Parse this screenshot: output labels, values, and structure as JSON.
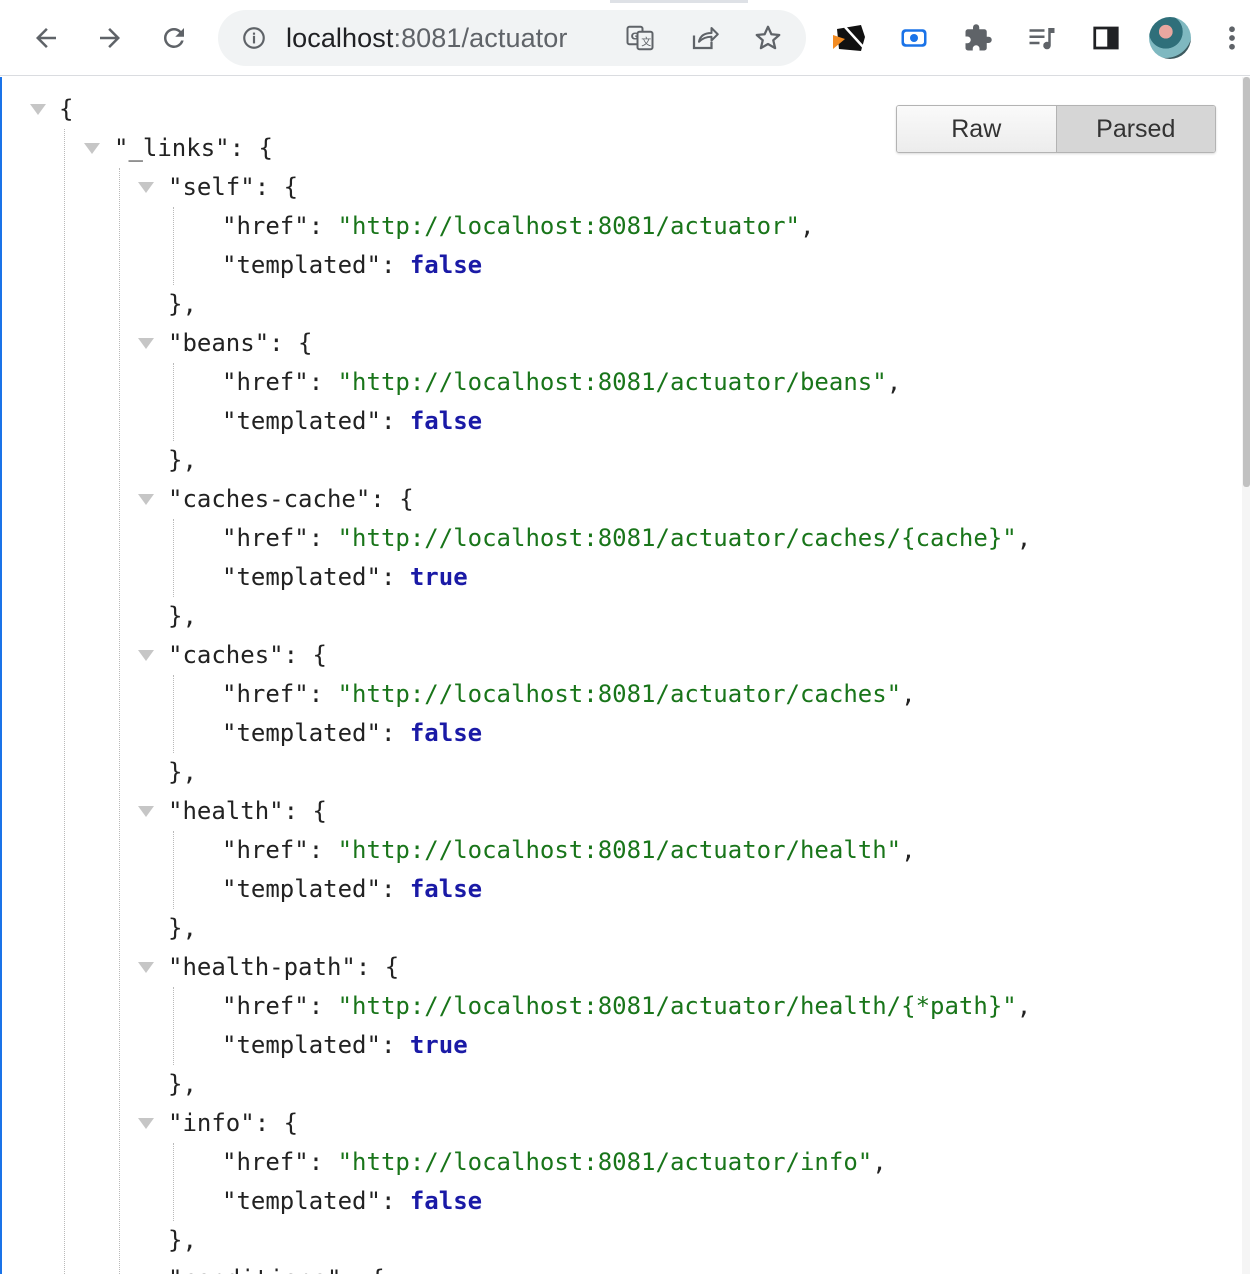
{
  "browser": {
    "url_host": "localhost",
    "url_port_path": ":8081/actuator",
    "icons": {
      "back": "arrow-left-icon",
      "forward": "arrow-right-icon",
      "reload": "reload-icon",
      "info": "info-icon",
      "translate": "translate-icon",
      "share": "share-icon",
      "bookmark": "star-icon",
      "extension1": "json-extension-icon",
      "extension2": "screen-record-icon",
      "extensions": "puzzle-icon",
      "media": "media-queue-icon",
      "sidepanel": "side-panel-icon",
      "profile": "profile-avatar",
      "menu": "kebab-menu-icon"
    }
  },
  "viewer": {
    "raw_label": "Raw",
    "parsed_label": "Parsed",
    "root_open": "{",
    "links_key": "\"_links\"",
    "links_open": ": {",
    "entries": [
      {
        "key": "\"self\"",
        "href": "\"http://localhost:8081/actuator\"",
        "templated": "false"
      },
      {
        "key": "\"beans\"",
        "href": "\"http://localhost:8081/actuator/beans\"",
        "templated": "false"
      },
      {
        "key": "\"caches-cache\"",
        "href": "\"http://localhost:8081/actuator/caches/{cache}\"",
        "templated": "true"
      },
      {
        "key": "\"caches\"",
        "href": "\"http://localhost:8081/actuator/caches\"",
        "templated": "false"
      },
      {
        "key": "\"health\"",
        "href": "\"http://localhost:8081/actuator/health\"",
        "templated": "false"
      },
      {
        "key": "\"health-path\"",
        "href": "\"http://localhost:8081/actuator/health/{*path}\"",
        "templated": "true"
      },
      {
        "key": "\"info\"",
        "href": "\"http://localhost:8081/actuator/info\"",
        "templated": "false"
      }
    ],
    "href_key": "\"href\"",
    "templated_key": "\"templated\"",
    "entry_open": ": {",
    "entry_close": "},",
    "colon": ": ",
    "comma": ",",
    "partial_next": "\"conditions\": {"
  },
  "colors": {
    "string": "#19751a",
    "boolean": "#1a1aa6",
    "accent": "#1a73e8"
  }
}
